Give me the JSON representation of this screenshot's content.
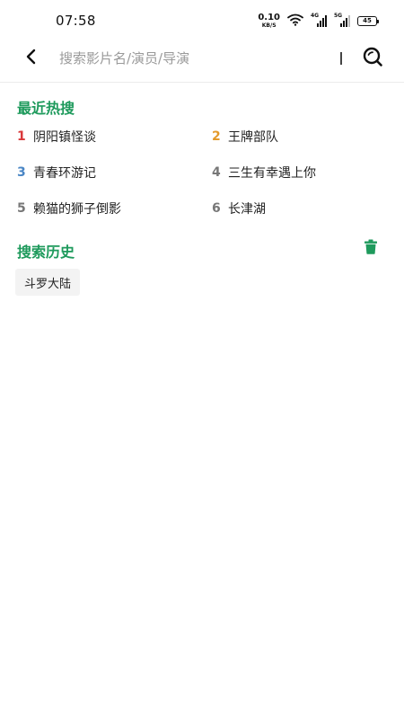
{
  "status_bar": {
    "time": "07:58",
    "net_speed_value": "0.10",
    "net_speed_unit": "KB/S",
    "signal_1_label": "4G",
    "signal_2_label": "5G",
    "battery_level": "45"
  },
  "search": {
    "placeholder": "搜索影片名/演员/导演",
    "value": ""
  },
  "hot_search": {
    "title": "最近热搜",
    "items": [
      {
        "rank": "1",
        "label": "阴阳镇怪谈"
      },
      {
        "rank": "2",
        "label": "王牌部队"
      },
      {
        "rank": "3",
        "label": "青春环游记"
      },
      {
        "rank": "4",
        "label": "三生有幸遇上你"
      },
      {
        "rank": "5",
        "label": "赖猫的狮子倒影"
      },
      {
        "rank": "6",
        "label": "长津湖"
      }
    ]
  },
  "history": {
    "title": "搜索历史",
    "items": [
      "斗罗大陆"
    ]
  },
  "colors": {
    "accent": "#1e9a5c",
    "rank_1": "#d9383a",
    "rank_2": "#e49a2b",
    "rank_3": "#4a86c5",
    "rank_other": "#777777"
  },
  "icons": [
    "back-arrow-icon",
    "search-icon",
    "wifi-icon",
    "signal-icon",
    "battery-icon",
    "trash-icon"
  ]
}
